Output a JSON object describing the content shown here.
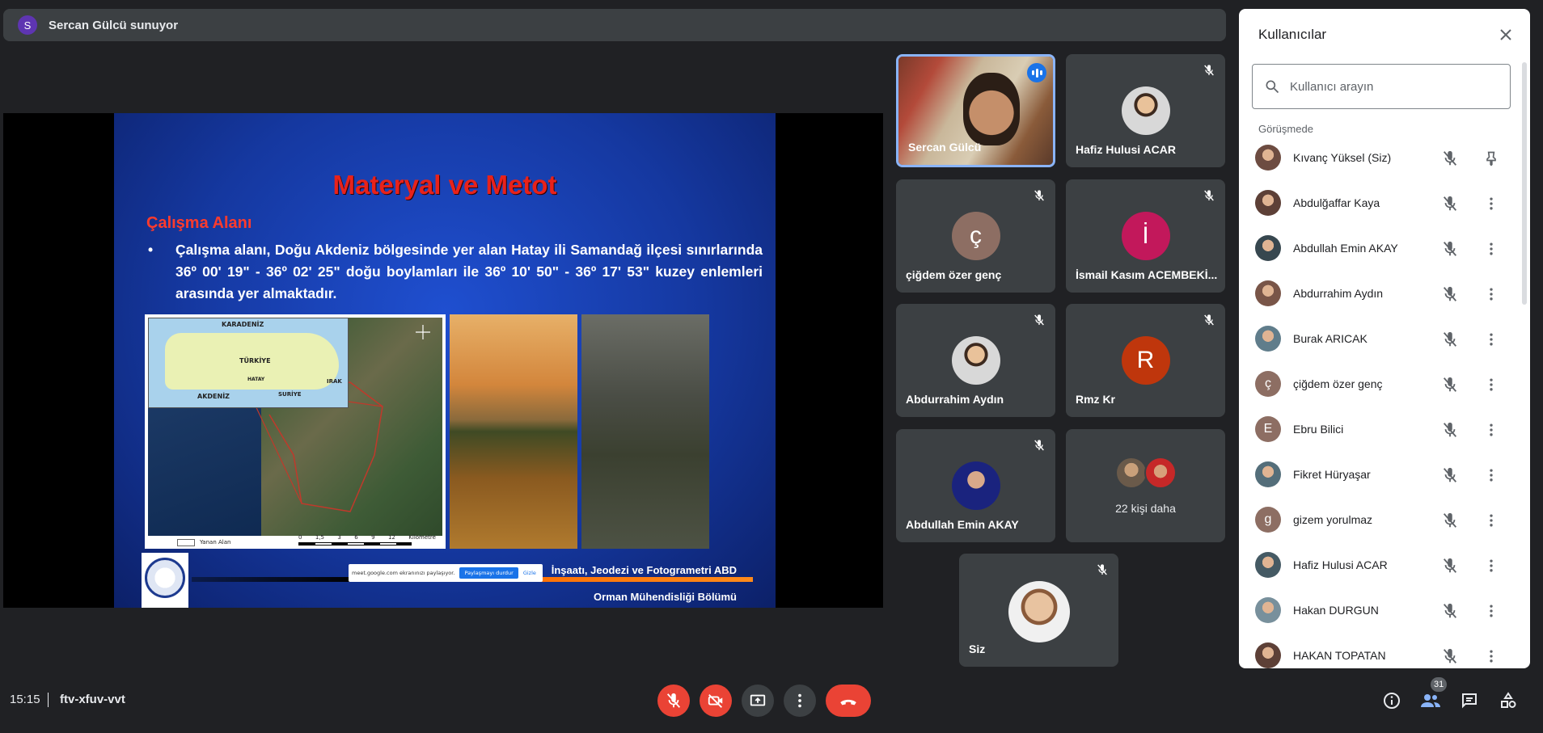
{
  "presenter": {
    "initial": "S",
    "text": "Sercan Gülcü sunuyor"
  },
  "slide": {
    "title": "Materyal ve Metot",
    "subtitle": "Çalışma Alanı",
    "bullet": "•",
    "bullet_text": "Çalışma alanı, Doğu Akdeniz bölgesinde yer alan Hatay ili Samandağ ilçesi sınırlarında 36º 00' 19\" - 36º 02' 25\" doğu boylamları ile 36º 10' 50\" - 36º 17' 53\" kuzey enlemleri arasında yer almaktadır.",
    "map_labels": {
      "karadeniz": "KARADENİZ",
      "turkiye": "TÜRKİYE",
      "hatay": "HATAY",
      "irak": "IRAK",
      "akdeniz": "AKDENİZ",
      "suriye": "SURİYE"
    },
    "legend_label": "Yanan Alan",
    "scale_ticks": [
      "0",
      "1,5",
      "3",
      "6",
      "9",
      "12"
    ],
    "scale_unit": "Kilometre",
    "footer_line1": "İnşaatı, Jeodezi ve Fotogrametri ABD",
    "footer_line2": "Orman Mühendisliği Bölümü",
    "share_banner": {
      "text": "meet.google.com ekranınızı paylaşıyor.",
      "stop": "Paylaşmayı durdur",
      "hide": "Gizle"
    }
  },
  "tiles": [
    {
      "name": "Sercan Gülcü",
      "type": "video",
      "speaking": true
    },
    {
      "name": "Hafiz Hulusi ACAR",
      "type": "photo",
      "muted": true
    },
    {
      "name": "çiğdem özer genç",
      "type": "letter",
      "initial": "ç",
      "color": "#8d6e63",
      "muted": true
    },
    {
      "name": "İsmail Kasım ACEMBEKİ...",
      "type": "letter",
      "initial": "İ",
      "color": "#c2185b",
      "muted": true
    },
    {
      "name": "Abdurrahim Aydın",
      "type": "photo",
      "muted": true
    },
    {
      "name": "Rmz Kr",
      "type": "letter",
      "initial": "R",
      "color": "#bf360c",
      "muted": true
    },
    {
      "name": "Abdullah Emin AKAY",
      "type": "photo",
      "muted": true
    },
    {
      "name": "22 kişi daha",
      "type": "more"
    },
    {
      "name": "Siz",
      "type": "photo",
      "muted": true
    }
  ],
  "panel": {
    "title": "Kullanıcılar",
    "search_placeholder": "Kullanıcı arayın",
    "section": "Görüşmede",
    "users": [
      {
        "name": "Kıvanç Yüksel (Siz)",
        "avatar": "photo",
        "color": "#6d4c41",
        "action": "pin-icon"
      },
      {
        "name": "Abdulğaffar Kaya",
        "avatar": "photo",
        "color": "#5d4037",
        "action": "more-vert-icon"
      },
      {
        "name": "Abdullah Emin AKAY",
        "avatar": "photo",
        "color": "#37474f",
        "action": "more-vert-icon"
      },
      {
        "name": "Abdurrahim Aydın",
        "avatar": "photo",
        "color": "#795548",
        "action": "more-vert-icon"
      },
      {
        "name": "Burak ARICAK",
        "avatar": "photo",
        "color": "#607d8b",
        "action": "more-vert-icon"
      },
      {
        "name": "çiğdem özer genç",
        "avatar": "letter",
        "initial": "ç",
        "color": "#8d6e63",
        "action": "more-vert-icon"
      },
      {
        "name": "Ebru Bilici",
        "avatar": "letter",
        "initial": "E",
        "color": "#8d6e63",
        "action": "more-vert-icon"
      },
      {
        "name": "Fikret Hüryaşar",
        "avatar": "photo",
        "color": "#546e7a",
        "action": "more-vert-icon"
      },
      {
        "name": "gizem yorulmaz",
        "avatar": "letter",
        "initial": "g",
        "color": "#8d6e63",
        "action": "more-vert-icon"
      },
      {
        "name": "Hafiz Hulusi ACAR",
        "avatar": "photo",
        "color": "#455a64",
        "action": "more-vert-icon"
      },
      {
        "name": "Hakan DURGUN",
        "avatar": "photo",
        "color": "#78909c",
        "action": "more-vert-icon"
      },
      {
        "name": "HAKAN TOPATAN",
        "avatar": "photo",
        "color": "#5d4037",
        "action": "more-vert-icon"
      }
    ]
  },
  "bottom": {
    "time": "15:15",
    "meeting_code": "ftv-xfuv-vvt",
    "participant_count": "31"
  },
  "colors": {
    "accent_red": "#ea4335",
    "accent_blue": "#1a73e8",
    "bg": "#202124",
    "tile": "#3c4043"
  }
}
